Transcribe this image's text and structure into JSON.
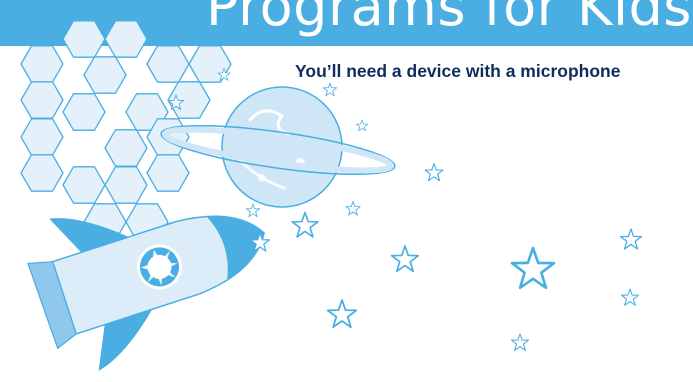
{
  "header": {
    "title": "Programs for Kids"
  },
  "notice": {
    "text": "You’ll need a device with a microphone"
  },
  "illustration": {
    "elements": [
      "hexagon-mirror",
      "planet",
      "rocket",
      "stars"
    ],
    "colors": {
      "band": "#4aaee3",
      "light_blue": "#d8ebf8",
      "mid_blue": "#bcdcf2",
      "outline": "#4aaee3",
      "text_dark": "#0f2c5c"
    }
  }
}
